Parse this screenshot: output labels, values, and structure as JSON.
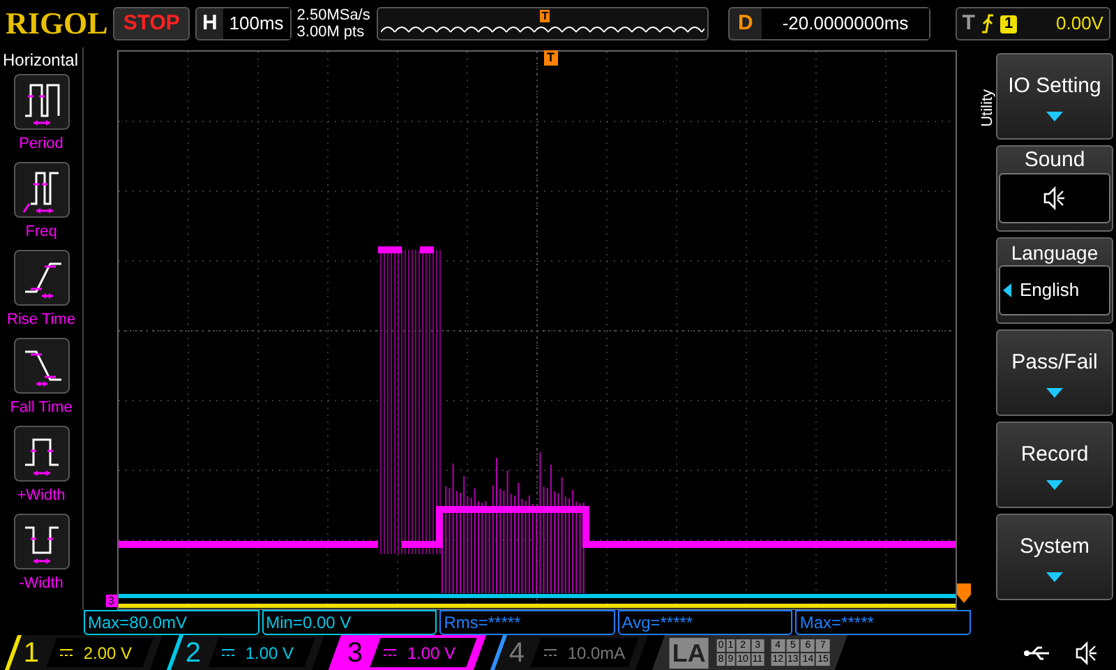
{
  "brand": "RIGOL",
  "run_state": "STOP",
  "horizontal": {
    "label": "H",
    "value": "100ms"
  },
  "sample_rate": "2.50MSa/s",
  "memory_depth": "3.00M pts",
  "overview_trigger_marker": "T",
  "grid_trigger_marker": "T",
  "delay": {
    "label": "D",
    "value": "-20.0000000ms"
  },
  "trigger": {
    "label": "T",
    "source": "1",
    "level": "0.00V"
  },
  "left_menu": {
    "title": "Horizontal",
    "items": [
      {
        "label": "Period",
        "kind": "period"
      },
      {
        "label": "Freq",
        "kind": "freq"
      },
      {
        "label": "Rise Time",
        "kind": "rise"
      },
      {
        "label": "Fall Time",
        "kind": "fall"
      },
      {
        "label": "+Width",
        "kind": "pwidth"
      },
      {
        "label": "-Width",
        "kind": "nwidth"
      }
    ]
  },
  "channel_marker": "3",
  "right_menu": {
    "title": "Utility",
    "items": [
      {
        "label": "IO Setting",
        "kind": "submenu"
      },
      {
        "label": "Sound",
        "kind": "sound",
        "on": true
      },
      {
        "label": "Language",
        "kind": "select",
        "value": "English"
      },
      {
        "label": "Pass/Fail",
        "kind": "submenu"
      },
      {
        "label": "Record",
        "kind": "submenu"
      },
      {
        "label": "System",
        "kind": "submenu"
      }
    ]
  },
  "measurements": [
    {
      "text": "Max=80.0mV",
      "color": "#00c8e8"
    },
    {
      "text": "Min=0.00 V",
      "color": "#00c8e8"
    },
    {
      "text": "Rms=*****",
      "color": "#1e80ff"
    },
    {
      "text": "Avg=*****",
      "color": "#1e80ff"
    },
    {
      "text": "Max=*****",
      "color": "#1e80ff"
    }
  ],
  "channels": [
    {
      "number": "1",
      "scale": "2.00 V",
      "color": "#f0e000",
      "on": true,
      "selected": false
    },
    {
      "number": "2",
      "scale": "1.00 V",
      "color": "#00c8e8",
      "on": true,
      "selected": false
    },
    {
      "number": "3",
      "scale": "1.00 V",
      "color": "#ff00ff",
      "on": true,
      "selected": true
    },
    {
      "number": "4",
      "scale": "10.0mA",
      "color": "#3090ff",
      "on": false,
      "selected": false
    }
  ],
  "la": {
    "label": "LA",
    "bits": [
      "0",
      "1",
      "2",
      "3",
      "4",
      "5",
      "6",
      "7",
      "8",
      "9",
      "10",
      "11",
      "12",
      "13",
      "14",
      "15"
    ]
  }
}
